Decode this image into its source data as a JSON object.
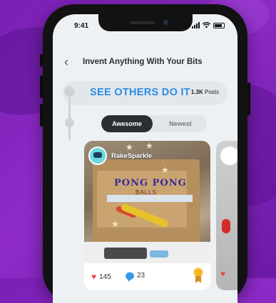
{
  "status_bar": {
    "time": "9:41"
  },
  "nav": {
    "back_icon": "chevron-left-icon",
    "back_glyph": "‹",
    "title": "Invent Anything With Your Bits"
  },
  "section": {
    "title": "SEE OTHERS DO IT",
    "count": "1.3K",
    "count_label": "Posts"
  },
  "tabs": [
    {
      "label": "Awesome",
      "active": true
    },
    {
      "label": "Newest",
      "active": false
    }
  ],
  "card": {
    "username": "RakeSparkle",
    "image_title_text": "PONG PONG",
    "image_sub_text": "BALLS",
    "likes": "145",
    "comments": "23",
    "award_icon": "medal-icon"
  },
  "colors": {
    "background": "#8e2bc7",
    "accent": "#2f8de4",
    "active_tab": "#2b2f33",
    "heart": "#e94c4c",
    "comment": "#3298e8",
    "medal": "#f2b51e"
  }
}
